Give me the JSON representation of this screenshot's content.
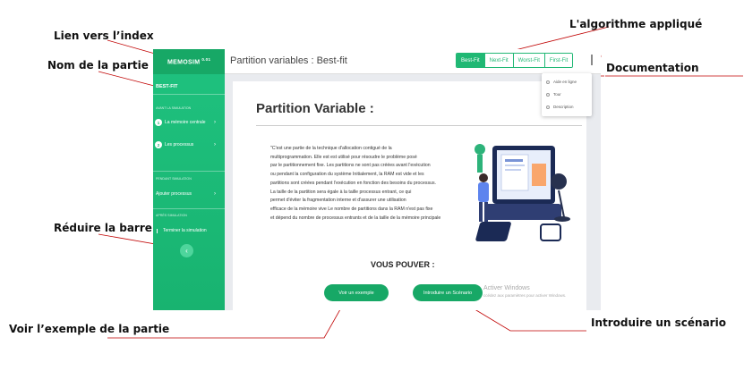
{
  "annotations": {
    "index_link": "Lien vers l’index",
    "part_name": "Nom de la partie",
    "collapse_bar": "Réduire la barre",
    "see_example": "Voir l’exemple  de la partie",
    "algorithm": "L'algorithme  appliqué",
    "documentation": "Documentation",
    "scenario": "Introduire un scénario"
  },
  "sidebar": {
    "brand": "MEMOSIM",
    "version": "0.01",
    "part_title": "BEST-FIT",
    "section_before": "AVANT LA SIMULATION",
    "item_memory_num": "1",
    "item_memory": "La mémoire centrale",
    "item_process_num": "2",
    "item_process": "Les processus",
    "section_during": "PENDANT SIMULATION",
    "item_add_process": "Ajouter processus",
    "section_after": "APRÈS SIMULATION",
    "item_end": "Terminer la simulation",
    "collapse_icon": "‹"
  },
  "topbar": {
    "title": "Partition variables : Best-fit",
    "tabs": [
      "Best-Fit",
      "Next-Fit",
      "Worst-Fit",
      "First-Fit"
    ],
    "active_tab": "Best-Fit"
  },
  "menu": {
    "items": [
      "Aide en ligne",
      "Tour",
      "Description"
    ]
  },
  "content": {
    "heading": "Partition Variable :",
    "paragraph": [
      "\"C'est une partie de la technique d'allocation contigué de la",
      "multiprogrammation. Elle est est utilisé pour résoudre le problème posé",
      "par le partitionnement fixe. Les partitions ne sont pas créées avant l'exécution",
      "ou pendant la configuration du système Initialement, la RAM est vide et les",
      "partitions sont créées pendant l'exécution en fonction des besoins du processus.",
      "La taille de la partition sera égale à la taille processus entrant, ce qui",
      "permet d'éviter la fragmentation interne et d'assurer une utilisation",
      "efficace de la mémoire vive Le nombre de partitions dans la RAM n'est pas fixe",
      "et dépend du nombre de processus entrants et de la taille de la mémoire principale"
    ],
    "vous_pouver": "VOUS POUVER :",
    "btn_example": "Voir un exemple",
    "btn_scenario": "Introduire un Scénario",
    "watermark_title": "Activer Windows",
    "watermark_sub": "ccédez aux paramètres pour activer Windows."
  },
  "colors": {
    "sidebar": "#1fc27f",
    "accent": "#17a866",
    "annotation_line": "#c00000"
  }
}
